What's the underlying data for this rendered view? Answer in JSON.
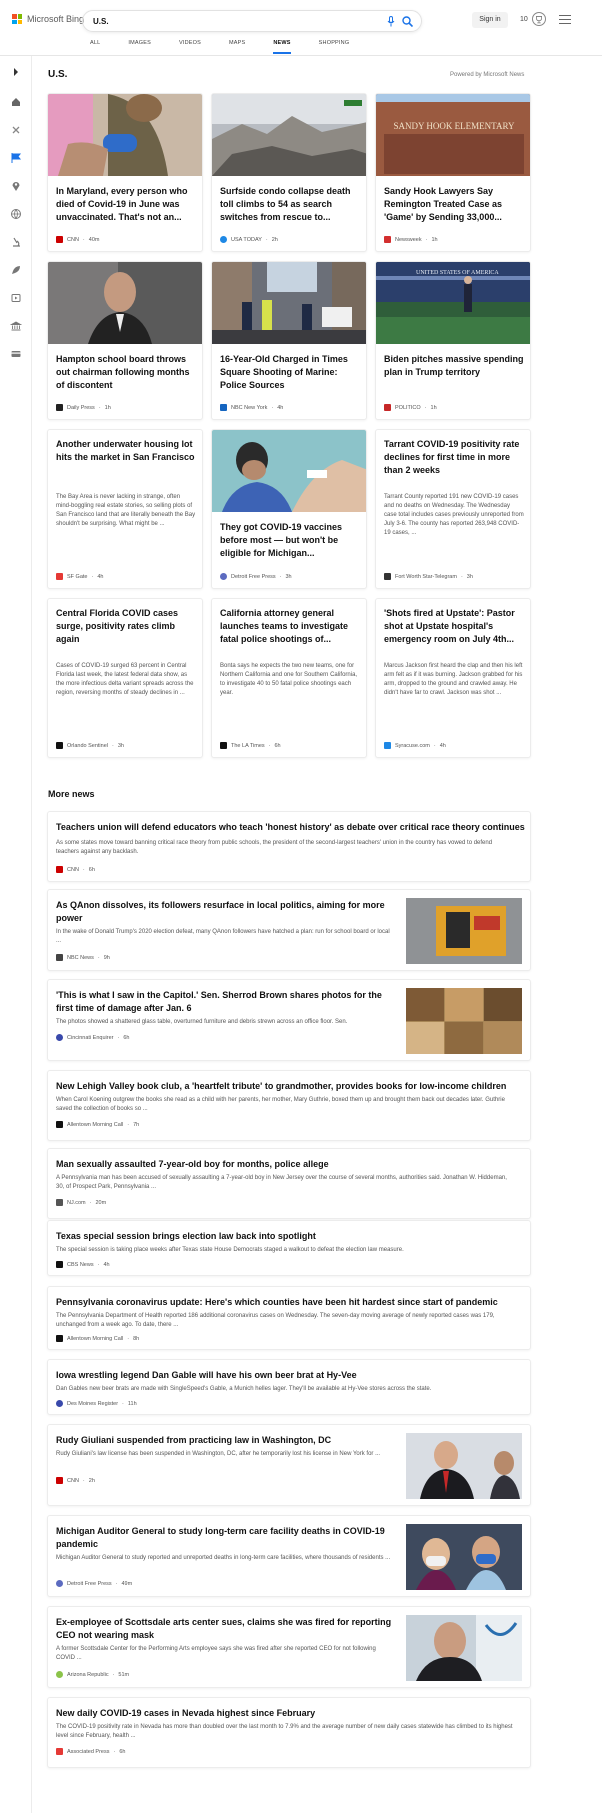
{
  "header": {
    "logo_text": "Microsoft Bing",
    "search_value": "U.S.",
    "signin_label": "Sign in",
    "points": "10",
    "tabs": [
      "ALL",
      "IMAGES",
      "VIDEOS",
      "MAPS",
      "NEWS",
      "SHOPPING"
    ],
    "active_tab": "NEWS"
  },
  "section": {
    "title": "U.S.",
    "powered": "Powered by Microsoft News"
  },
  "cards": [
    {
      "title": "In Maryland, every person who died of Covid-19 in June was unvaccinated. That's not an...",
      "snippet": "",
      "source": "CNN",
      "time": "40m",
      "src_color": "#cc0000",
      "image": "vaccine-photo"
    },
    {
      "title": "Surfside condo collapse death toll climbs to 54 as search switches from rescue to...",
      "snippet": "",
      "source": "USA TODAY",
      "time": "2h",
      "src_color": "#1e88e5",
      "image": "rubble-photo"
    },
    {
      "title": "Sandy Hook Lawyers Say Remington Treated Case as 'Game' by Sending 33,000...",
      "snippet": "",
      "source": "Newsweek",
      "time": "1h",
      "src_color": "#d32f2f",
      "image": "school-sign-photo",
      "sign_text": "SANDY HOOK ELEMENTARY"
    },
    {
      "title": "Hampton school board throws out chairman following months of discontent",
      "snippet": "",
      "source": "Daily Press",
      "time": "1h",
      "src_color": "#222222",
      "image": "man-profile-photo"
    },
    {
      "title": "16-Year-Old Charged in Times Square Shooting of Marine: Police Sources",
      "snippet": "",
      "source": "NBC New York",
      "time": "4h",
      "src_color": "#1565c0",
      "image": "police-street-photo"
    },
    {
      "title": "Biden pitches massive spending plan in Trump territory",
      "snippet": "",
      "source": "POLITICO",
      "time": "1h",
      "src_color": "#c62828",
      "image": "air-force-one-photo",
      "plane_text": "UNITED STATES OF AMERICA"
    },
    {
      "title": "Another underwater housing lot hits the market in San Francisco",
      "snippet": "The Bay Area is never lacking in strange, often mind-boggling real estate stories, so selling plots of San Francisco land that are literally beneath the Bay shouldn't be surprising. What might be ...",
      "source": "SF Gate",
      "time": "4h",
      "src_color": "#e53935",
      "image": ""
    },
    {
      "title": "They got COVID-19 vaccines before most — but won't be eligible for Michigan...",
      "snippet": "",
      "source": "Detroit Free Press",
      "time": "3h",
      "src_color": "#5c6bc0",
      "image": "nurse-vaccine-photo"
    },
    {
      "title": "Tarrant COVID-19 positivity rate declines for first time in more than 2 weeks",
      "snippet": "Tarrant County reported 191 new COVID-19 cases and no deaths on Wednesday. The Wednesday case total includes cases previously unreported from July 3-6. The county has reported 263,948 COVID-19 cases, ...",
      "source": "Fort Worth Star-Telegram",
      "time": "3h",
      "src_color": "#333333",
      "image": ""
    },
    {
      "title": "Central Florida COVID cases surge, positivity rates climb again",
      "snippet": "Cases of COVID-19 surged 63 percent in Central Florida last week, the latest federal data show, as the more infectious delta variant spreads across the region, reversing months of steady declines in ...",
      "source": "Orlando Sentinel",
      "time": "3h",
      "src_color": "#111111",
      "image": ""
    },
    {
      "title": "California attorney general launches teams to investigate fatal police shootings of...",
      "snippet": "Bonta says he expects the two new teams, one for Northern California and one for Southern California, to investigate 40 to 50 fatal police shootings each year.",
      "source": "The LA Times",
      "time": "6h",
      "src_color": "#111111",
      "image": ""
    },
    {
      "title": "'Shots fired at Upstate': Pastor shot at Upstate hospital's emergency room on July 4th...",
      "snippet": "Marcus Jackson first heard the clap and then his left arm felt as if it was burning. Jackson grabbed for his arm, dropped to the ground and crawled away. He didn't have far to crawl. Jackson was shot ...",
      "source": "Syracuse.com",
      "time": "4h",
      "src_color": "#1e88e5",
      "image": ""
    }
  ],
  "more_news_title": "More news",
  "more_news": [
    {
      "title": "Teachers union will defend educators who teach 'honest history' as debate over critical race theory continues",
      "snippet": "As some states move toward banning critical race theory from public schools, the president of the second-largest teachers' union in the country has vowed to defend teachers against any backlash.",
      "source": "CNN",
      "time": "6h",
      "src_color": "#cc0000",
      "thumb": ""
    },
    {
      "title": "As QAnon dissolves, its followers resurface in local politics, aiming for more power",
      "snippet": "In the wake of Donald Trump's 2020 election defeat, many QAnon followers have hatched a plan: run for school board or local ...",
      "source": "NBC News",
      "time": "9h",
      "src_color": "#444444",
      "thumb": "qanon-photo"
    },
    {
      "title": "'This is what I saw in the Capitol.' Sen. Sherrod Brown shares photos for the first time of damage after Jan. 6",
      "snippet": "The photos showed a shattered glass table, overturned furniture and debris strewn across an office floor.  Sen.",
      "source": "Cincinnati Enquirer",
      "time": "6h",
      "src_color": "#3949ab",
      "thumb": "capitol-photo"
    },
    {
      "title": "New Lehigh Valley book club, a 'heartfelt tribute' to grandmother, provides books for low-income children",
      "snippet": "When Carol Koening outgrew the books she read as a child with her parents, her mother, Mary Guthrie, boxed them up and brought them back out decades later. Guthrie saved the collection of books so ...",
      "source": "Allentown Morning Call",
      "time": "7h",
      "src_color": "#111111",
      "thumb": ""
    },
    {
      "title": "Man sexually assaulted 7-year-old boy for months, police allege",
      "snippet": "A Pennsylvania man has been accused of sexually assaulting a 7-year-old boy in New Jersey over the course of several months, authorities said. Jonathan W. Hiddeman, 30, of Prospect Park, Pennsylvania ...",
      "source": "NJ.com",
      "time": "20m",
      "src_color": "#555555",
      "thumb": ""
    },
    {
      "title": "Texas special session brings election law back into spotlight",
      "snippet": "The special session is taking place weeks after Texas state House Democrats staged a walkout to defeat the election law measure.",
      "source": "CBS News",
      "time": "4h",
      "src_color": "#111111",
      "thumb": ""
    },
    {
      "title": "Pennsylvania coronavirus update: Here's which counties have been hit hardest since start of pandemic",
      "snippet": "The Pennsylvania Department of Health reported 186 additional coronavirus cases on Wednesday. The seven-day moving average of newly reported cases was 179, unchanged from a week ago. To date, there ...",
      "source": "Allentown Morning Call",
      "time": "8h",
      "src_color": "#111111",
      "thumb": ""
    },
    {
      "title": "Iowa wrestling legend Dan Gable will have his own beer brat at Hy-Vee",
      "snippet": "Dan Gables new beer brats are made with SingleSpeed's Gable, a Munich helles lager. They'll be available at Hy-Vee stores across the state.",
      "source": "Des Moines Register",
      "time": "11h",
      "src_color": "#3949ab",
      "thumb": ""
    },
    {
      "title": "Rudy Giuliani suspended from practicing law in Washington, DC",
      "snippet": "Rudy Giuliani's law license has been suspended in Washington, DC, after he temporarily lost his license in New York for ...",
      "source": "CNN",
      "time": "2h",
      "src_color": "#cc0000",
      "thumb": "giuliani-photo"
    },
    {
      "title": "Michigan Auditor General to study long-term care facility deaths in COVID-19 pandemic",
      "snippet": "Michigan Auditor General to study reported and unreported deaths in long-term care facilities, where thousands of residents ...",
      "source": "Detroit Free Press",
      "time": "49m",
      "src_color": "#5c6bc0",
      "thumb": "masks-photo"
    },
    {
      "title": "Ex-employee of Scottsdale arts center sues, claims she was fired for reporting CEO not wearing mask",
      "snippet": "A former Scottsdale Center for the Performing Arts employee says she was fired after she reported CEO for not following COVID ...",
      "source": "Arizona Republic",
      "time": "51m",
      "src_color": "#8bc34a",
      "thumb": "ceo-photo"
    },
    {
      "title": "New daily COVID-19 cases in Nevada highest since February",
      "snippet": "The COVID-19 positivity rate in Nevada has more than doubled over the last month to 7.9% and the average number of new daily cases statewide has climbed to its highest level since February, health ...",
      "source": "Associated Press",
      "time": "6h",
      "src_color": "#e53935",
      "thumb": ""
    }
  ]
}
